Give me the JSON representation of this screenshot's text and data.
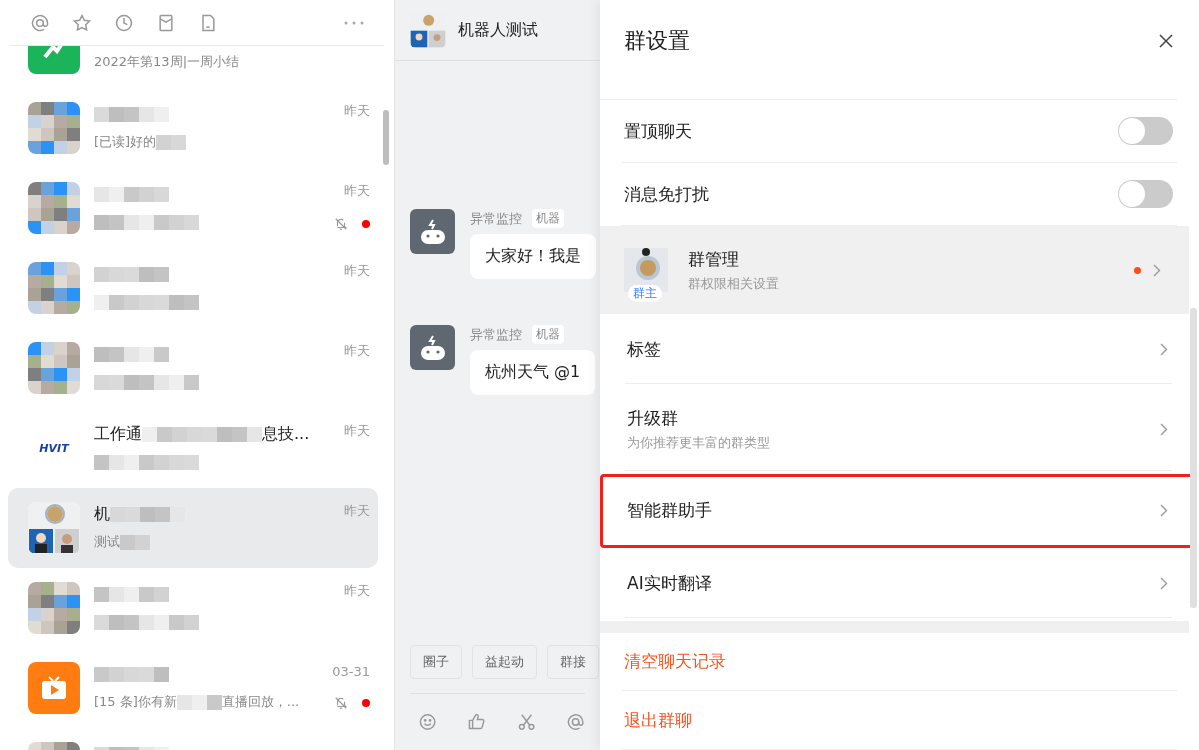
{
  "chat_list": {
    "chats": [
      {
        "avatar": {
          "kind": "app-green"
        },
        "preview": "2022年第13周|一周小结",
        "muted": false,
        "unread": false,
        "selected": false,
        "redacted": false
      },
      {
        "avatar": {
          "kind": "mosaic"
        },
        "preview": "[已读]好的",
        "time": "昨天",
        "muted": false,
        "unread": false,
        "selected": false,
        "redacted": true
      },
      {
        "avatar": {
          "kind": "mosaic"
        },
        "time": "昨天",
        "muted": true,
        "unread": true,
        "selected": false,
        "redacted": true
      },
      {
        "avatar": {
          "kind": "mosaic"
        },
        "time": "昨天",
        "muted": false,
        "unread": false,
        "selected": false,
        "redacted": true
      },
      {
        "avatar": {
          "kind": "mosaic"
        },
        "time": "昨天",
        "muted": false,
        "unread": false,
        "selected": false,
        "redacted": true
      },
      {
        "avatar": {
          "kind": "logo",
          "text": "HVIT"
        },
        "title": "工作通",
        "title_tail": "息技...",
        "time": "昨天",
        "muted": false,
        "unread": false,
        "selected": false,
        "redacted": true
      },
      {
        "avatar": {
          "kind": "group"
        },
        "title": "机",
        "preview": "测试",
        "time": "昨天",
        "muted": false,
        "unread": false,
        "selected": true,
        "redacted": true
      },
      {
        "avatar": {
          "kind": "mosaic"
        },
        "time": "昨天",
        "muted": false,
        "unread": false,
        "selected": false,
        "redacted": true
      },
      {
        "avatar": {
          "kind": "app-orange"
        },
        "preview": "[15 条]你有新",
        "preview_tail": "直播回放，...",
        "time": "03-31",
        "muted": true,
        "unread": true,
        "selected": false,
        "redacted": true
      },
      {
        "avatar": {
          "kind": "mosaic"
        },
        "muted": false,
        "unread": false,
        "selected": false,
        "redacted": true
      }
    ]
  },
  "chat": {
    "title": "机器人测试",
    "messages": [
      {
        "sender": "异常监控",
        "tag": "机器",
        "text": "大家好！我是"
      },
      {
        "sender": "异常监控",
        "tag": "机器",
        "text": "杭州天气 @1"
      }
    ],
    "quick_replies": [
      "圈子",
      "益起动",
      "群接"
    ]
  },
  "settings": {
    "title": "群设置",
    "toggles": [
      {
        "label": "置顶聊天",
        "on": false
      },
      {
        "label": "消息免打扰",
        "on": false
      }
    ],
    "manage": {
      "badge": "群主",
      "title": "群管理",
      "subtitle": "群权限相关设置",
      "dot": true
    },
    "rows": [
      {
        "label": "标签",
        "highlighted": false
      },
      {
        "label": "升级群",
        "subtitle": "为你推荐更丰富的群类型",
        "highlighted": false
      },
      {
        "label": "智能群助手",
        "highlighted": true
      },
      {
        "label": "AI实时翻译",
        "highlighted": false
      }
    ],
    "actions": [
      "清空聊天记录",
      "退出群聊"
    ]
  }
}
